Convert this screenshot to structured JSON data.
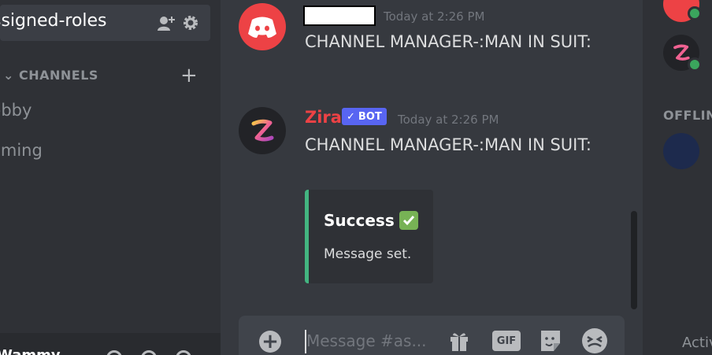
{
  "sidebar": {
    "selected_channel": "ssigned-roles",
    "category": "CHANNELS",
    "channels": [
      "bbby",
      "aming"
    ],
    "user_name": "Wammy"
  },
  "chat": {
    "messages": [
      {
        "author": "",
        "timestamp": "Today at 2:26 PM",
        "text": "CHANNEL MANAGER-:MAN IN SUIT:",
        "avatar": "discord-icon",
        "author_redacted": true
      },
      {
        "author": "Zira",
        "badge": "BOT",
        "timestamp": "Today at 2:26 PM",
        "text": "CHANNEL MANAGER-:MAN IN SUIT:",
        "avatar": "zira-logo",
        "embed": {
          "title": "Success",
          "description": "Message set.",
          "accent": "#43b581"
        }
      }
    ],
    "composer": {
      "placeholder": "Message #as..."
    }
  },
  "members": {
    "offline_header": "OFFLIN",
    "activity_label": "Activ"
  },
  "colors": {
    "author_zira": "#ed4245",
    "bot_badge": "#5865f2",
    "online": "#3ba55d",
    "discord_red": "#ed4245"
  }
}
